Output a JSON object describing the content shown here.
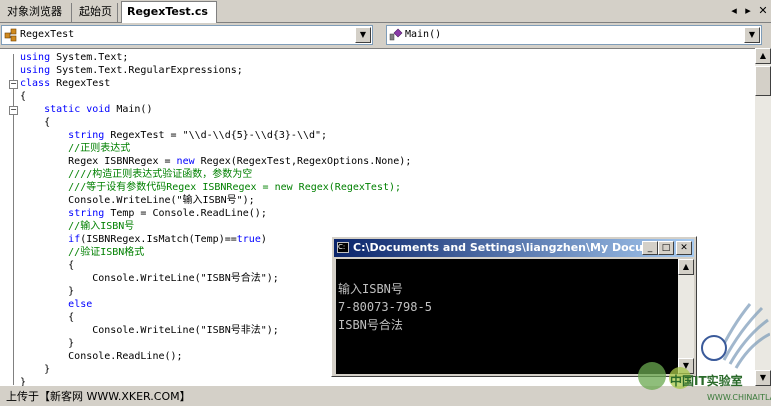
{
  "tabs": [
    {
      "label": "对象浏览器",
      "active": false
    },
    {
      "label": "起始页",
      "active": false
    },
    {
      "label": "RegexTest.cs",
      "active": true
    }
  ],
  "tab_controls": {
    "prev_icon": "◂",
    "next_icon": "▸",
    "close_icon": "✕"
  },
  "class_combo": {
    "value": "RegexTest",
    "icon": "class-icon"
  },
  "member_combo": {
    "value": "Main()",
    "icon": "method-icon"
  },
  "code_lines": [
    [
      {
        "t": "using",
        "c": "kw"
      },
      {
        "t": " System.Text;",
        "c": ""
      }
    ],
    [
      {
        "t": "using",
        "c": "kw"
      },
      {
        "t": " System.Text.RegularExpressions;",
        "c": ""
      }
    ],
    [
      {
        "t": "class",
        "c": "kw"
      },
      {
        "t": " RegexTest",
        "c": ""
      }
    ],
    [
      {
        "t": "{",
        "c": ""
      }
    ],
    [
      {
        "t": "    ",
        "c": ""
      },
      {
        "t": "static void",
        "c": "kw"
      },
      {
        "t": " Main()",
        "c": ""
      }
    ],
    [
      {
        "t": "    {",
        "c": ""
      }
    ],
    [
      {
        "t": "        ",
        "c": ""
      },
      {
        "t": "string",
        "c": "kw"
      },
      {
        "t": " RegexTest = \"\\\\d-\\\\d{5}-\\\\d{3}-\\\\d\";",
        "c": ""
      }
    ],
    [
      {
        "t": "        //正则表达式",
        "c": "cm"
      }
    ],
    [
      {
        "t": "        Regex ISBNRegex = ",
        "c": ""
      },
      {
        "t": "new",
        "c": "kw"
      },
      {
        "t": " Regex(RegexTest,RegexOptions.None);",
        "c": ""
      }
    ],
    [
      {
        "t": "        ////构造正则表达式验证函数，参数为空",
        "c": "cm"
      }
    ],
    [
      {
        "t": "        ///等于设有参数代码Regex ISBNRegex = new Regex(RegexTest);",
        "c": "cm"
      }
    ],
    [
      {
        "t": "        Console.WriteLine(\"输入ISBN号\");",
        "c": ""
      }
    ],
    [
      {
        "t": "        ",
        "c": ""
      },
      {
        "t": "string",
        "c": "kw"
      },
      {
        "t": " Temp = Console.ReadLine();",
        "c": ""
      }
    ],
    [
      {
        "t": "        //输入ISBN号",
        "c": "cm"
      }
    ],
    [
      {
        "t": "        ",
        "c": ""
      },
      {
        "t": "if",
        "c": "kw"
      },
      {
        "t": "(ISBNRegex.IsMatch(Temp)==",
        "c": ""
      },
      {
        "t": "true",
        "c": "kw"
      },
      {
        "t": ")",
        "c": ""
      }
    ],
    [
      {
        "t": "        //验证ISBN格式",
        "c": "cm"
      }
    ],
    [
      {
        "t": "        {",
        "c": ""
      }
    ],
    [
      {
        "t": "            Console.WriteLine(\"ISBN号合法\");",
        "c": ""
      }
    ],
    [
      {
        "t": "        }",
        "c": ""
      }
    ],
    [
      {
        "t": "        ",
        "c": ""
      },
      {
        "t": "else",
        "c": "kw"
      }
    ],
    [
      {
        "t": "        {",
        "c": ""
      }
    ],
    [
      {
        "t": "            Console.WriteLine(\"ISBN号非法\");",
        "c": ""
      }
    ],
    [
      {
        "t": "        }",
        "c": ""
      }
    ],
    [
      {
        "t": "        Console.ReadLine();",
        "c": ""
      }
    ],
    [
      {
        "t": "    }",
        "c": ""
      }
    ],
    [
      {
        "t": "}",
        "c": ""
      }
    ]
  ],
  "status_text": "上传于【新客网 WWW.XKER.COM】",
  "console": {
    "title": "C:\\Documents and Settings\\liangzhen\\My Docum...",
    "buttons": {
      "minimize": "_",
      "maximize": "□",
      "close": "✕"
    },
    "output": [
      "输入ISBN号",
      "7-80073-798-5",
      "ISBN号合法"
    ]
  },
  "watermark": {
    "line1": "中国IT实验室",
    "line2": "WWW.CHINAITLAB.COM"
  },
  "colors": {
    "keyword": "#0000ff",
    "comment": "#008000",
    "title_bar": "#0a246a",
    "console_bg": "#000000"
  }
}
